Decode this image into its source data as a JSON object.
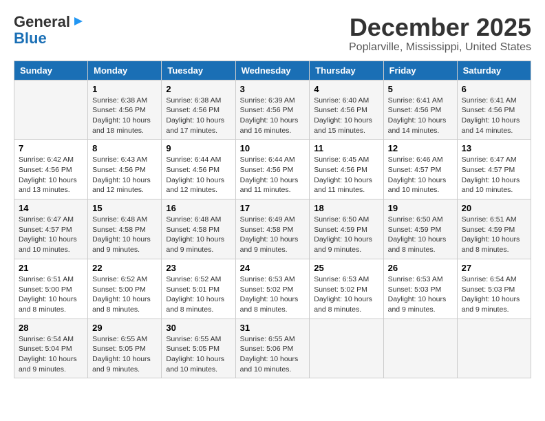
{
  "logo": {
    "line1": "General",
    "line2": "Blue"
  },
  "title": "December 2025",
  "subtitle": "Poplarville, Mississippi, United States",
  "days_of_week": [
    "Sunday",
    "Monday",
    "Tuesday",
    "Wednesday",
    "Thursday",
    "Friday",
    "Saturday"
  ],
  "weeks": [
    [
      {
        "day": "",
        "info": ""
      },
      {
        "day": "1",
        "info": "Sunrise: 6:38 AM\nSunset: 4:56 PM\nDaylight: 10 hours\nand 18 minutes."
      },
      {
        "day": "2",
        "info": "Sunrise: 6:38 AM\nSunset: 4:56 PM\nDaylight: 10 hours\nand 17 minutes."
      },
      {
        "day": "3",
        "info": "Sunrise: 6:39 AM\nSunset: 4:56 PM\nDaylight: 10 hours\nand 16 minutes."
      },
      {
        "day": "4",
        "info": "Sunrise: 6:40 AM\nSunset: 4:56 PM\nDaylight: 10 hours\nand 15 minutes."
      },
      {
        "day": "5",
        "info": "Sunrise: 6:41 AM\nSunset: 4:56 PM\nDaylight: 10 hours\nand 14 minutes."
      },
      {
        "day": "6",
        "info": "Sunrise: 6:41 AM\nSunset: 4:56 PM\nDaylight: 10 hours\nand 14 minutes."
      }
    ],
    [
      {
        "day": "7",
        "info": "Sunrise: 6:42 AM\nSunset: 4:56 PM\nDaylight: 10 hours\nand 13 minutes."
      },
      {
        "day": "8",
        "info": "Sunrise: 6:43 AM\nSunset: 4:56 PM\nDaylight: 10 hours\nand 12 minutes."
      },
      {
        "day": "9",
        "info": "Sunrise: 6:44 AM\nSunset: 4:56 PM\nDaylight: 10 hours\nand 12 minutes."
      },
      {
        "day": "10",
        "info": "Sunrise: 6:44 AM\nSunset: 4:56 PM\nDaylight: 10 hours\nand 11 minutes."
      },
      {
        "day": "11",
        "info": "Sunrise: 6:45 AM\nSunset: 4:56 PM\nDaylight: 10 hours\nand 11 minutes."
      },
      {
        "day": "12",
        "info": "Sunrise: 6:46 AM\nSunset: 4:57 PM\nDaylight: 10 hours\nand 10 minutes."
      },
      {
        "day": "13",
        "info": "Sunrise: 6:47 AM\nSunset: 4:57 PM\nDaylight: 10 hours\nand 10 minutes."
      }
    ],
    [
      {
        "day": "14",
        "info": "Sunrise: 6:47 AM\nSunset: 4:57 PM\nDaylight: 10 hours\nand 10 minutes."
      },
      {
        "day": "15",
        "info": "Sunrise: 6:48 AM\nSunset: 4:58 PM\nDaylight: 10 hours\nand 9 minutes."
      },
      {
        "day": "16",
        "info": "Sunrise: 6:48 AM\nSunset: 4:58 PM\nDaylight: 10 hours\nand 9 minutes."
      },
      {
        "day": "17",
        "info": "Sunrise: 6:49 AM\nSunset: 4:58 PM\nDaylight: 10 hours\nand 9 minutes."
      },
      {
        "day": "18",
        "info": "Sunrise: 6:50 AM\nSunset: 4:59 PM\nDaylight: 10 hours\nand 9 minutes."
      },
      {
        "day": "19",
        "info": "Sunrise: 6:50 AM\nSunset: 4:59 PM\nDaylight: 10 hours\nand 8 minutes."
      },
      {
        "day": "20",
        "info": "Sunrise: 6:51 AM\nSunset: 4:59 PM\nDaylight: 10 hours\nand 8 minutes."
      }
    ],
    [
      {
        "day": "21",
        "info": "Sunrise: 6:51 AM\nSunset: 5:00 PM\nDaylight: 10 hours\nand 8 minutes."
      },
      {
        "day": "22",
        "info": "Sunrise: 6:52 AM\nSunset: 5:00 PM\nDaylight: 10 hours\nand 8 minutes."
      },
      {
        "day": "23",
        "info": "Sunrise: 6:52 AM\nSunset: 5:01 PM\nDaylight: 10 hours\nand 8 minutes."
      },
      {
        "day": "24",
        "info": "Sunrise: 6:53 AM\nSunset: 5:02 PM\nDaylight: 10 hours\nand 8 minutes."
      },
      {
        "day": "25",
        "info": "Sunrise: 6:53 AM\nSunset: 5:02 PM\nDaylight: 10 hours\nand 8 minutes."
      },
      {
        "day": "26",
        "info": "Sunrise: 6:53 AM\nSunset: 5:03 PM\nDaylight: 10 hours\nand 9 minutes."
      },
      {
        "day": "27",
        "info": "Sunrise: 6:54 AM\nSunset: 5:03 PM\nDaylight: 10 hours\nand 9 minutes."
      }
    ],
    [
      {
        "day": "28",
        "info": "Sunrise: 6:54 AM\nSunset: 5:04 PM\nDaylight: 10 hours\nand 9 minutes."
      },
      {
        "day": "29",
        "info": "Sunrise: 6:55 AM\nSunset: 5:05 PM\nDaylight: 10 hours\nand 9 minutes."
      },
      {
        "day": "30",
        "info": "Sunrise: 6:55 AM\nSunset: 5:05 PM\nDaylight: 10 hours\nand 10 minutes."
      },
      {
        "day": "31",
        "info": "Sunrise: 6:55 AM\nSunset: 5:06 PM\nDaylight: 10 hours\nand 10 minutes."
      },
      {
        "day": "",
        "info": ""
      },
      {
        "day": "",
        "info": ""
      },
      {
        "day": "",
        "info": ""
      }
    ]
  ]
}
